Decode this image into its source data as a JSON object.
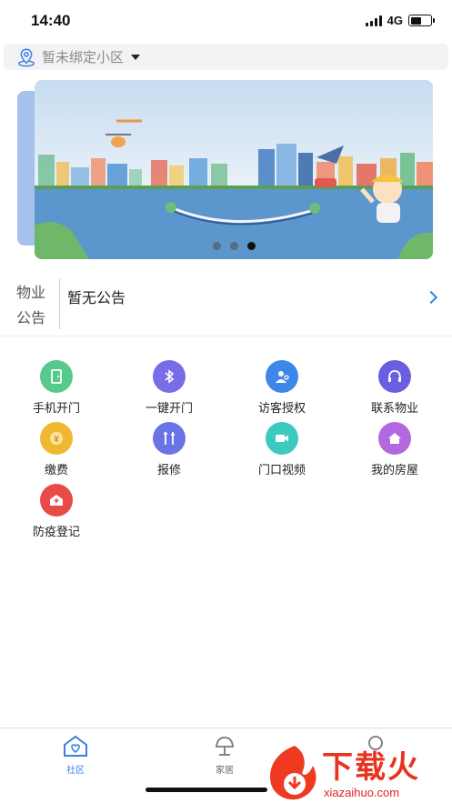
{
  "status_bar": {
    "time": "14:40",
    "network": "4G",
    "battery_level": 0.55
  },
  "community": {
    "placeholder": "暂未绑定小区",
    "icon": "location-pin-icon"
  },
  "banner": {
    "slides_count": 3,
    "active_index": 2
  },
  "notice": {
    "label_line1": "物业",
    "label_line2": "公告",
    "text": "暂无公告"
  },
  "services": [
    {
      "label": "手机开门",
      "icon": "door-icon",
      "color": "#57c98a"
    },
    {
      "label": "一键开门",
      "icon": "bluetooth-icon",
      "color": "#7a6be6"
    },
    {
      "label": "访客授权",
      "icon": "visitor-key-icon",
      "color": "#3e86e8"
    },
    {
      "label": "联系物业",
      "icon": "headset-icon",
      "color": "#6a5fe0"
    },
    {
      "label": "缴费",
      "icon": "yuan-coin-icon",
      "color": "#f0b830"
    },
    {
      "label": "报修",
      "icon": "tools-icon",
      "color": "#6a74e6"
    },
    {
      "label": "门口视频",
      "icon": "video-camera-icon",
      "color": "#3ccac0"
    },
    {
      "label": "我的房屋",
      "icon": "house-icon",
      "color": "#b368e0"
    },
    {
      "label": "防疫登记",
      "icon": "clinic-icon",
      "color": "#e84a45"
    }
  ],
  "tabbar": {
    "tabs": [
      {
        "label": "社区",
        "icon": "community-home-icon",
        "active": true
      },
      {
        "label": "家居",
        "icon": "lamp-icon",
        "active": false
      },
      {
        "label": "",
        "icon": "profile-icon",
        "active": false
      }
    ]
  },
  "watermark": {
    "title": "下载火",
    "subtitle": "xiazaihuo.com"
  }
}
